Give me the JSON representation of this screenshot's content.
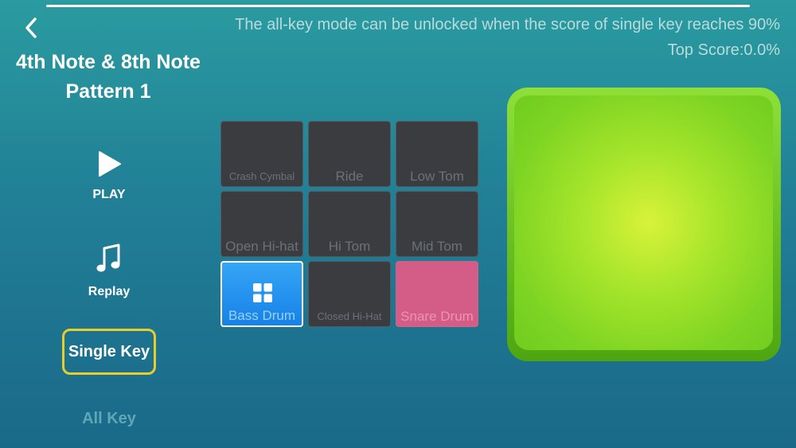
{
  "header": {
    "notice": "The all-key mode can be unlocked when the score of single key reaches 90%",
    "top_score": "Top Score:0.0%",
    "title_line1": "4th Note & 8th Note",
    "title_line2": "Pattern 1",
    "back_icon": "chevron-left-icon"
  },
  "sidebar": {
    "play_label": "PLAY",
    "play_icon": "play-icon",
    "replay_label": "Replay",
    "replay_icon": "music-note-icon",
    "single_key_label": "Single Key",
    "all_key_label": "All Key"
  },
  "pads": [
    {
      "label": "Crash Cymbal",
      "state": "idle"
    },
    {
      "label": "Ride",
      "state": "idle"
    },
    {
      "label": "Low Tom",
      "state": "idle"
    },
    {
      "label": "Open Hi-hat",
      "state": "idle"
    },
    {
      "label": "Hi Tom",
      "state": "idle"
    },
    {
      "label": "Mid Tom",
      "state": "idle"
    },
    {
      "label": "Bass Drum",
      "state": "selected",
      "icon": "grid-icon"
    },
    {
      "label": "Closed Hi-Hat",
      "state": "idle"
    },
    {
      "label": "Snare Drum",
      "state": "active"
    }
  ],
  "colors": {
    "background_top": "#2a9ba0",
    "background_bottom": "#1a6989",
    "single_key_border": "#e6cf2a",
    "bass_pad": "#1e8cf0",
    "snare_pad": "#d35d86",
    "big_pad": "#7ed423"
  }
}
